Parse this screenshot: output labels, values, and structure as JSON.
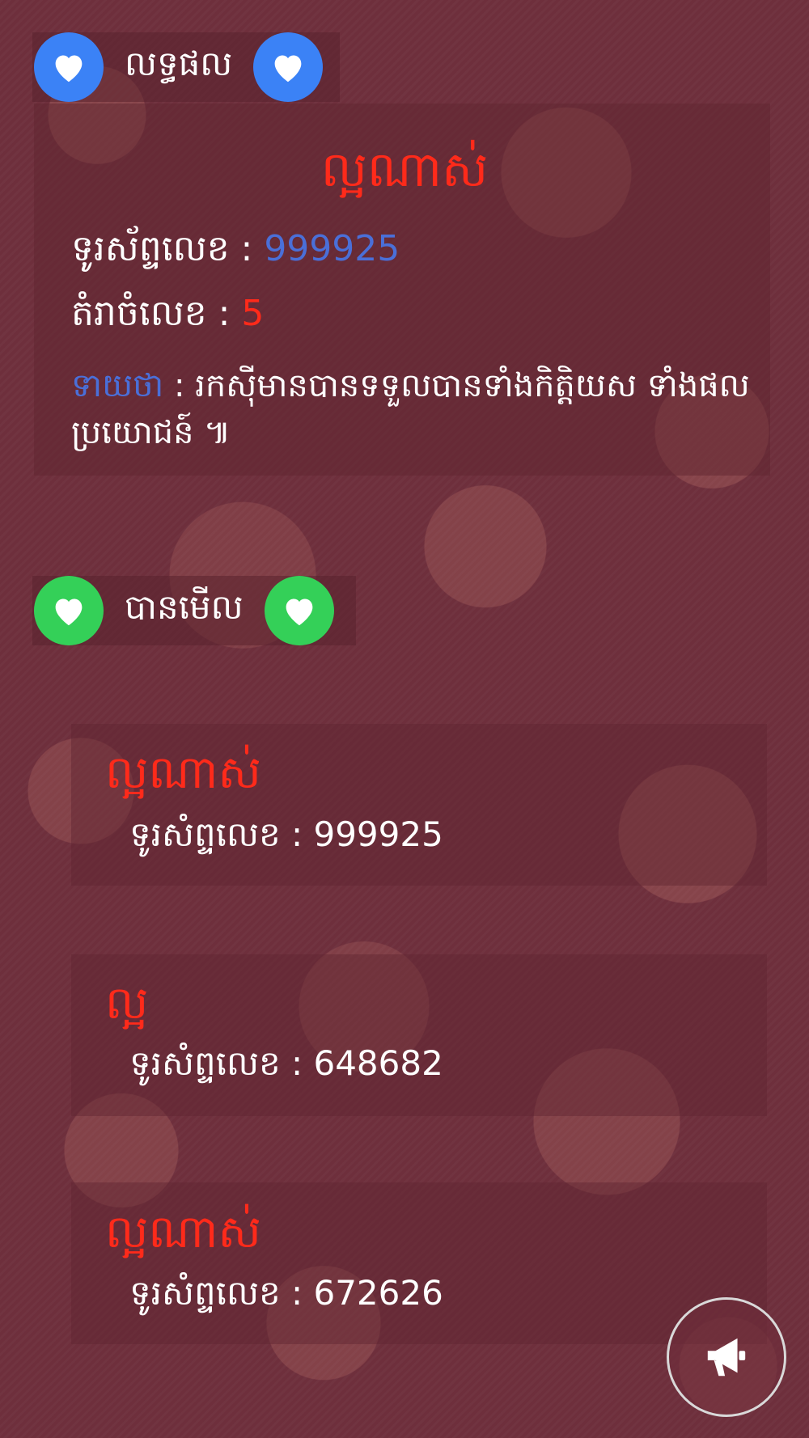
{
  "colors": {
    "accent_red": "#ff2a1a",
    "value_blue": "#4a6fd8",
    "heart_blue": "#3b82f6",
    "heart_green": "#34d058",
    "text_white": "#ffffff"
  },
  "result_section": {
    "header": "លទ្ធផល",
    "icon": "heart-icon",
    "title": "ល្អណាស់",
    "phone_label": "ទូរស័ព្ទលេខ : ",
    "phone_value": "999925",
    "sum_label": "តំរាចំលេខ : ",
    "sum_value": "5",
    "meaning_label": "ទាយថា",
    "meaning_text": " : រកស៊ីមានបានទទួលបានទាំងកិត្តិយស ទាំងផលប្រយោជន៍ ៕"
  },
  "history_section": {
    "header": "បានមើល",
    "icon": "heart-icon",
    "items": [
      {
        "title": "ល្អណាស់",
        "phone_label": "ទូរសំព្ទលេខ : ",
        "phone_value": "999925"
      },
      {
        "title": "ល្អ",
        "phone_label": "ទូរសំព្ទលេខ : ",
        "phone_value": "648682"
      },
      {
        "title": "ល្អណាស់",
        "phone_label": "ទូរសំព្ទលេខ : ",
        "phone_value": "672626"
      }
    ]
  },
  "fab": {
    "icon": "megaphone-icon"
  }
}
